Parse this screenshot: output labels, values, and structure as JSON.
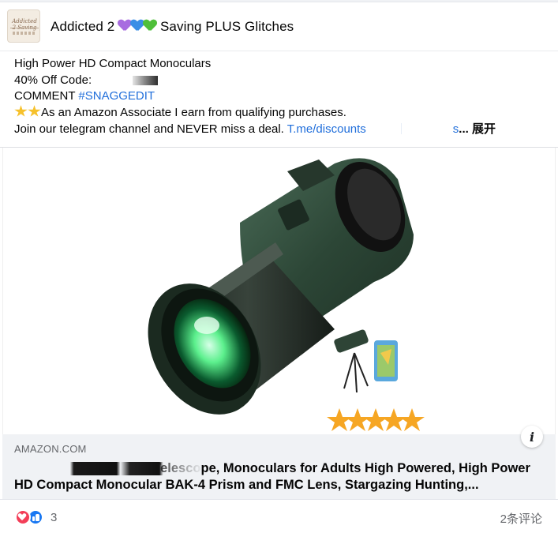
{
  "group": {
    "name": "Addicted 2 💜💙💚 Saving PLUS Glitches",
    "avatar_alt": "Addicted 2 Saving"
  },
  "post": {
    "line1": "High Power HD Compact Monoculars",
    "line2_prefix": "40% Off Code: ",
    "line3_prefix": "COMMENT ",
    "line3_hashtag": "#SNAGGEDIT",
    "line4_text": "As an Amazon Associate I earn from qualifying purchases.",
    "line5_text": "Join our telegram channel and NEVER miss a deal. ",
    "line5_link_start": "T.me/discounts",
    "line5_link_end": "s",
    "more_label": "... 展开"
  },
  "link_preview": {
    "domain": "AMAZON.COM",
    "title_line1": "3U...  Telescope, Monoculars for Adults High Powered, High Power",
    "title_line1_visible": "der Telescope, Monoculars for Adults High Powered, High Power",
    "title_line2": "HD Compact Monocular BAK-4 Prism and FMC Lens, Stargazing Hunting,...",
    "info_label": "i"
  },
  "product_image": {
    "rating_stars": 5
  },
  "footer": {
    "reaction_count": "3",
    "comments_label": "2条评论"
  },
  "colors": {
    "link_blue": "#216fdb",
    "like_blue": "#1877f2",
    "love_red": "#f33e58",
    "star_gold": "#f6a623",
    "monocular_green": "#2f4a3a"
  }
}
